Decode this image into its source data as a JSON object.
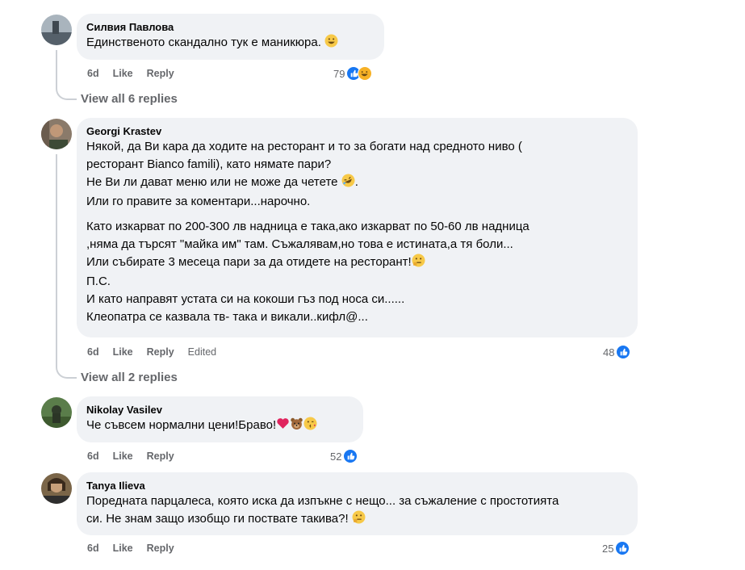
{
  "action_labels": {
    "like": "Like",
    "reply": "Reply",
    "edited": "Edited"
  },
  "comments": [
    {
      "author": "Силвия Павлова",
      "lines": [
        "Единственото скандално тук е маникюра."
      ],
      "time": "6d",
      "reactions": "79",
      "reaction_icons": [
        "like-icon",
        "haha-icon"
      ],
      "replies_link": "View all 6 replies"
    },
    {
      "author": "Georgi Krastev",
      "paragraph1": [
        "Някой, да Ви кара да ходите на ресторант и то за богати над средното ниво (",
        "ресторант Bianco famili), като нямате пари?",
        "Не Ви ли дават меню или не може да четете",
        "Или го правите за коментари...нарочно."
      ],
      "paragraph2": [
        "Като изкарват по 200-300 лв надница е така,ако изкарват по 50-60 лв надница",
        ",няма да търсят \"майка им\" там. Съжалявам,но това е истината,а тя боли...",
        "Или събирате 3 месеца пари за да отидете на ресторант!",
        "П.С.",
        "И като направят устата си на кокоши гъз под носа си......",
        "Клеопатра се казвала тв- така и викали..кифл@..."
      ],
      "time": "6d",
      "reactions": "48",
      "reaction_icons": [
        "like-icon"
      ],
      "replies_link": "View all 2 replies"
    },
    {
      "author": "Nikolay Vasilev",
      "lines": [
        "Че съвсем нормални цени!Браво!"
      ],
      "time": "6d",
      "reactions": "52",
      "reaction_icons": [
        "like-icon"
      ]
    },
    {
      "author": "Tanya Ilieva",
      "lines": [
        "Поредната парцалеса, която иска да изпъкне с нещо... за съжаление с простотията",
        "си. Не знам защо изобщо ги поствате такива?!"
      ],
      "time": "6d",
      "reactions": "25",
      "reaction_icons": [
        "like-icon"
      ]
    }
  ],
  "colors": {
    "like_blue": "#1877f2",
    "bubble_bg": "#f0f2f5",
    "meta_gray": "#65676b"
  }
}
